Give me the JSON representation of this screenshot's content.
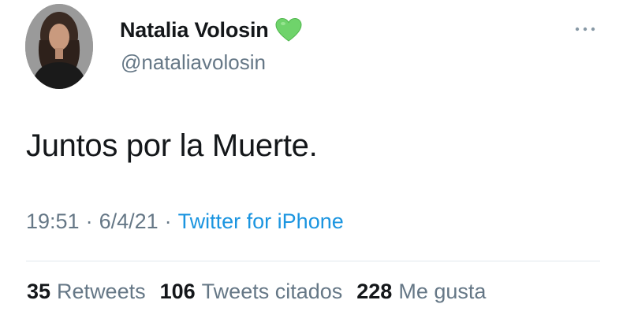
{
  "author": {
    "display_name": "Natalia Volosin",
    "handle": "@nataliavolosin",
    "badge_icon": "green-heart-icon",
    "avatar_icon": "profile-photo-avatar"
  },
  "tweet": {
    "text": "Juntos por la Muerte.",
    "time": "19:51",
    "date": "6/4/21",
    "separator": "·",
    "source": "Twitter for iPhone"
  },
  "menu": {
    "icon": "more-options-icon"
  },
  "stats": {
    "retweets_count": "35",
    "retweets_label": "Retweets",
    "quotes_count": "106",
    "quotes_label": "Tweets citados",
    "likes_count": "228",
    "likes_label": "Me gusta"
  },
  "colors": {
    "text_primary": "#14171a",
    "text_secondary": "#657786",
    "link": "#1b95e0",
    "heart": "#6fd36b",
    "divider": "#e1e8ed"
  }
}
